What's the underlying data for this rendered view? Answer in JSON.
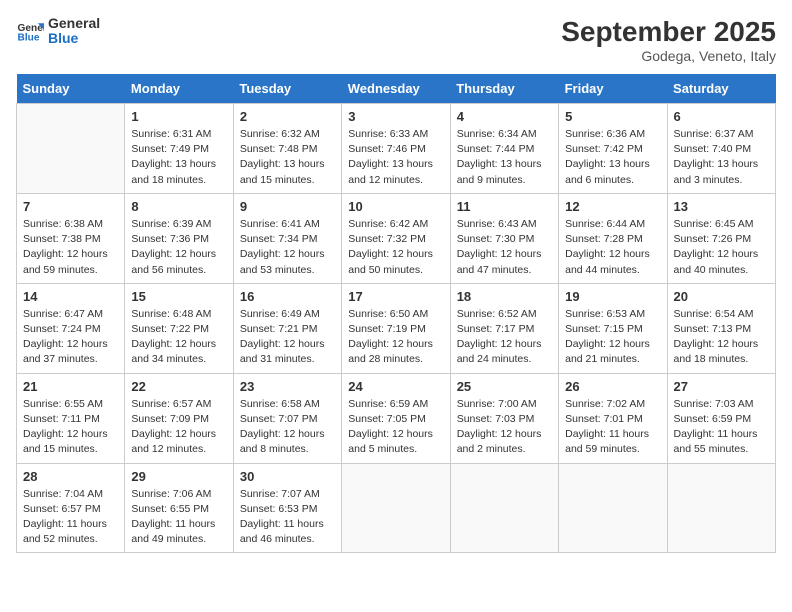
{
  "header": {
    "logo_line1": "General",
    "logo_line2": "Blue",
    "month": "September 2025",
    "location": "Godega, Veneto, Italy"
  },
  "days_of_week": [
    "Sunday",
    "Monday",
    "Tuesday",
    "Wednesday",
    "Thursday",
    "Friday",
    "Saturday"
  ],
  "weeks": [
    [
      {
        "day": "",
        "info": ""
      },
      {
        "day": "1",
        "info": "Sunrise: 6:31 AM\nSunset: 7:49 PM\nDaylight: 13 hours\nand 18 minutes."
      },
      {
        "day": "2",
        "info": "Sunrise: 6:32 AM\nSunset: 7:48 PM\nDaylight: 13 hours\nand 15 minutes."
      },
      {
        "day": "3",
        "info": "Sunrise: 6:33 AM\nSunset: 7:46 PM\nDaylight: 13 hours\nand 12 minutes."
      },
      {
        "day": "4",
        "info": "Sunrise: 6:34 AM\nSunset: 7:44 PM\nDaylight: 13 hours\nand 9 minutes."
      },
      {
        "day": "5",
        "info": "Sunrise: 6:36 AM\nSunset: 7:42 PM\nDaylight: 13 hours\nand 6 minutes."
      },
      {
        "day": "6",
        "info": "Sunrise: 6:37 AM\nSunset: 7:40 PM\nDaylight: 13 hours\nand 3 minutes."
      }
    ],
    [
      {
        "day": "7",
        "info": "Sunrise: 6:38 AM\nSunset: 7:38 PM\nDaylight: 12 hours\nand 59 minutes."
      },
      {
        "day": "8",
        "info": "Sunrise: 6:39 AM\nSunset: 7:36 PM\nDaylight: 12 hours\nand 56 minutes."
      },
      {
        "day": "9",
        "info": "Sunrise: 6:41 AM\nSunset: 7:34 PM\nDaylight: 12 hours\nand 53 minutes."
      },
      {
        "day": "10",
        "info": "Sunrise: 6:42 AM\nSunset: 7:32 PM\nDaylight: 12 hours\nand 50 minutes."
      },
      {
        "day": "11",
        "info": "Sunrise: 6:43 AM\nSunset: 7:30 PM\nDaylight: 12 hours\nand 47 minutes."
      },
      {
        "day": "12",
        "info": "Sunrise: 6:44 AM\nSunset: 7:28 PM\nDaylight: 12 hours\nand 44 minutes."
      },
      {
        "day": "13",
        "info": "Sunrise: 6:45 AM\nSunset: 7:26 PM\nDaylight: 12 hours\nand 40 minutes."
      }
    ],
    [
      {
        "day": "14",
        "info": "Sunrise: 6:47 AM\nSunset: 7:24 PM\nDaylight: 12 hours\nand 37 minutes."
      },
      {
        "day": "15",
        "info": "Sunrise: 6:48 AM\nSunset: 7:22 PM\nDaylight: 12 hours\nand 34 minutes."
      },
      {
        "day": "16",
        "info": "Sunrise: 6:49 AM\nSunset: 7:21 PM\nDaylight: 12 hours\nand 31 minutes."
      },
      {
        "day": "17",
        "info": "Sunrise: 6:50 AM\nSunset: 7:19 PM\nDaylight: 12 hours\nand 28 minutes."
      },
      {
        "day": "18",
        "info": "Sunrise: 6:52 AM\nSunset: 7:17 PM\nDaylight: 12 hours\nand 24 minutes."
      },
      {
        "day": "19",
        "info": "Sunrise: 6:53 AM\nSunset: 7:15 PM\nDaylight: 12 hours\nand 21 minutes."
      },
      {
        "day": "20",
        "info": "Sunrise: 6:54 AM\nSunset: 7:13 PM\nDaylight: 12 hours\nand 18 minutes."
      }
    ],
    [
      {
        "day": "21",
        "info": "Sunrise: 6:55 AM\nSunset: 7:11 PM\nDaylight: 12 hours\nand 15 minutes."
      },
      {
        "day": "22",
        "info": "Sunrise: 6:57 AM\nSunset: 7:09 PM\nDaylight: 12 hours\nand 12 minutes."
      },
      {
        "day": "23",
        "info": "Sunrise: 6:58 AM\nSunset: 7:07 PM\nDaylight: 12 hours\nand 8 minutes."
      },
      {
        "day": "24",
        "info": "Sunrise: 6:59 AM\nSunset: 7:05 PM\nDaylight: 12 hours\nand 5 minutes."
      },
      {
        "day": "25",
        "info": "Sunrise: 7:00 AM\nSunset: 7:03 PM\nDaylight: 12 hours\nand 2 minutes."
      },
      {
        "day": "26",
        "info": "Sunrise: 7:02 AM\nSunset: 7:01 PM\nDaylight: 11 hours\nand 59 minutes."
      },
      {
        "day": "27",
        "info": "Sunrise: 7:03 AM\nSunset: 6:59 PM\nDaylight: 11 hours\nand 55 minutes."
      }
    ],
    [
      {
        "day": "28",
        "info": "Sunrise: 7:04 AM\nSunset: 6:57 PM\nDaylight: 11 hours\nand 52 minutes."
      },
      {
        "day": "29",
        "info": "Sunrise: 7:06 AM\nSunset: 6:55 PM\nDaylight: 11 hours\nand 49 minutes."
      },
      {
        "day": "30",
        "info": "Sunrise: 7:07 AM\nSunset: 6:53 PM\nDaylight: 11 hours\nand 46 minutes."
      },
      {
        "day": "",
        "info": ""
      },
      {
        "day": "",
        "info": ""
      },
      {
        "day": "",
        "info": ""
      },
      {
        "day": "",
        "info": ""
      }
    ]
  ]
}
